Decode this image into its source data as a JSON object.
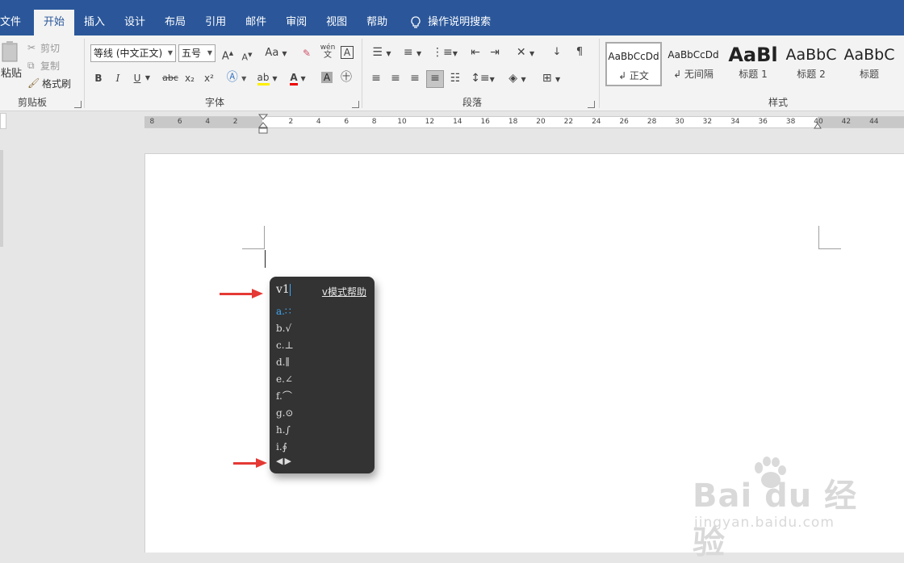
{
  "tabs": [
    "文件",
    "开始",
    "插入",
    "设计",
    "布局",
    "引用",
    "邮件",
    "审阅",
    "视图",
    "帮助"
  ],
  "tell_me": "操作说明搜索",
  "clipboard": {
    "paste": "粘贴",
    "cut": "剪切",
    "copy": "复制",
    "format_painter": "格式刷",
    "label": "剪贴板"
  },
  "font": {
    "name": "等线 (中文正文)",
    "size": "五号",
    "grow": "A",
    "shrink": "A",
    "case": "Aa",
    "pinyin_top": "wén",
    "pinyin_bottom": "文",
    "bold": "B",
    "italic": "I",
    "underline": "U",
    "strike": "abc",
    "sub": "x₂",
    "sup": "x²",
    "label": "字体"
  },
  "paragraph": {
    "label": "段落"
  },
  "styles": {
    "label": "样式",
    "items": [
      {
        "preview": "AaBbCcDd",
        "name": "↲ 正文"
      },
      {
        "preview": "AaBbCcDd",
        "name": "↲ 无间隔"
      },
      {
        "preview": "AaBl",
        "name": "标题 1"
      },
      {
        "preview": "AaBbC",
        "name": "标题 2"
      },
      {
        "preview": "AaBbC",
        "name": "标题"
      }
    ]
  },
  "ruler_labels": [
    "8",
    "6",
    "4",
    "2",
    "2",
    "4",
    "6",
    "8",
    "10",
    "12",
    "14",
    "16",
    "18",
    "20",
    "22",
    "24",
    "26",
    "28",
    "30",
    "32",
    "34",
    "36",
    "38",
    "40",
    "42",
    "44"
  ],
  "popup": {
    "input": "v1",
    "help": "v模式帮助",
    "options": [
      {
        "key": "a.",
        "sym": "∷"
      },
      {
        "key": "b.",
        "sym": "√"
      },
      {
        "key": "c.",
        "sym": "⊥"
      },
      {
        "key": "d.",
        "sym": "∥"
      },
      {
        "key": "e.",
        "sym": "∠"
      },
      {
        "key": "f.",
        "sym": "⌒"
      },
      {
        "key": "g.",
        "sym": "⊙"
      },
      {
        "key": "h.",
        "sym": "∫"
      },
      {
        "key": "i.",
        "sym": "∮"
      }
    ],
    "nav": "◀▶"
  },
  "watermark": {
    "logo": "Bai du 经验",
    "url": "jingyan.baidu.com"
  },
  "colors": {
    "ribbon_blue": "#2b579a",
    "popup_bg": "#333333",
    "popup_accent": "#3fa9f5",
    "arrow": "#e53935"
  }
}
